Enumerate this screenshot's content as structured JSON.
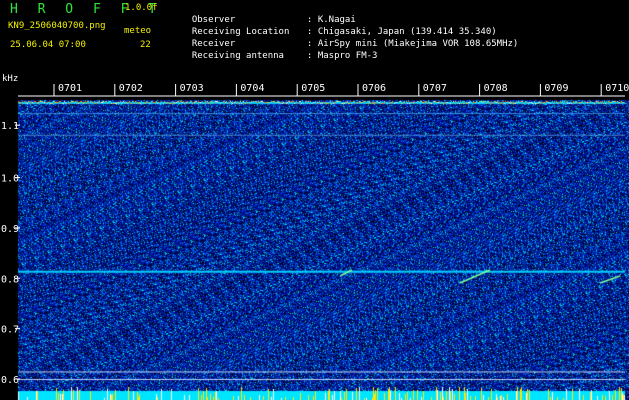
{
  "header": {
    "title": "H R O F F T",
    "version": "1.0.0f",
    "filename": "KN9_2506040700.png",
    "datetime": "25.06.04 07:00",
    "meteor_label": "meteo",
    "meteor_count": "22"
  },
  "station": [
    {
      "key": "Observer",
      "value": "K.Nagai"
    },
    {
      "key": "Receiving Location",
      "value": "Chigasaki, Japan (139.414 35.340)"
    },
    {
      "key": "Receiver",
      "value": "AirSpy mini (Miakejima VOR 108.65MHz)"
    },
    {
      "key": "Receiving antenna",
      "value": "Maspro FM-3"
    }
  ],
  "colors": {
    "background": "#000000",
    "header_text": "#ffffff",
    "accent_yellow": "#f2f200",
    "accent_green": "#2ee63a",
    "spectrogram_base": "#0a1a8c",
    "signal_cyan": "#00e5ff"
  },
  "chart_data": {
    "type": "heatmap",
    "ylabel": "kHz",
    "yticks": [
      "1.1",
      "1.0",
      "0.9",
      "0.8",
      "0.7",
      "0.6"
    ],
    "xticks": [
      "0701",
      "0702",
      "0703",
      "0704",
      "0705",
      "0706",
      "0707",
      "0708",
      "0709",
      "0710"
    ],
    "ylim": [
      0.58,
      1.17
    ],
    "carrier_lines_khz": [
      1.15,
      1.085,
      0.815,
      0.615,
      0.6
    ]
  }
}
